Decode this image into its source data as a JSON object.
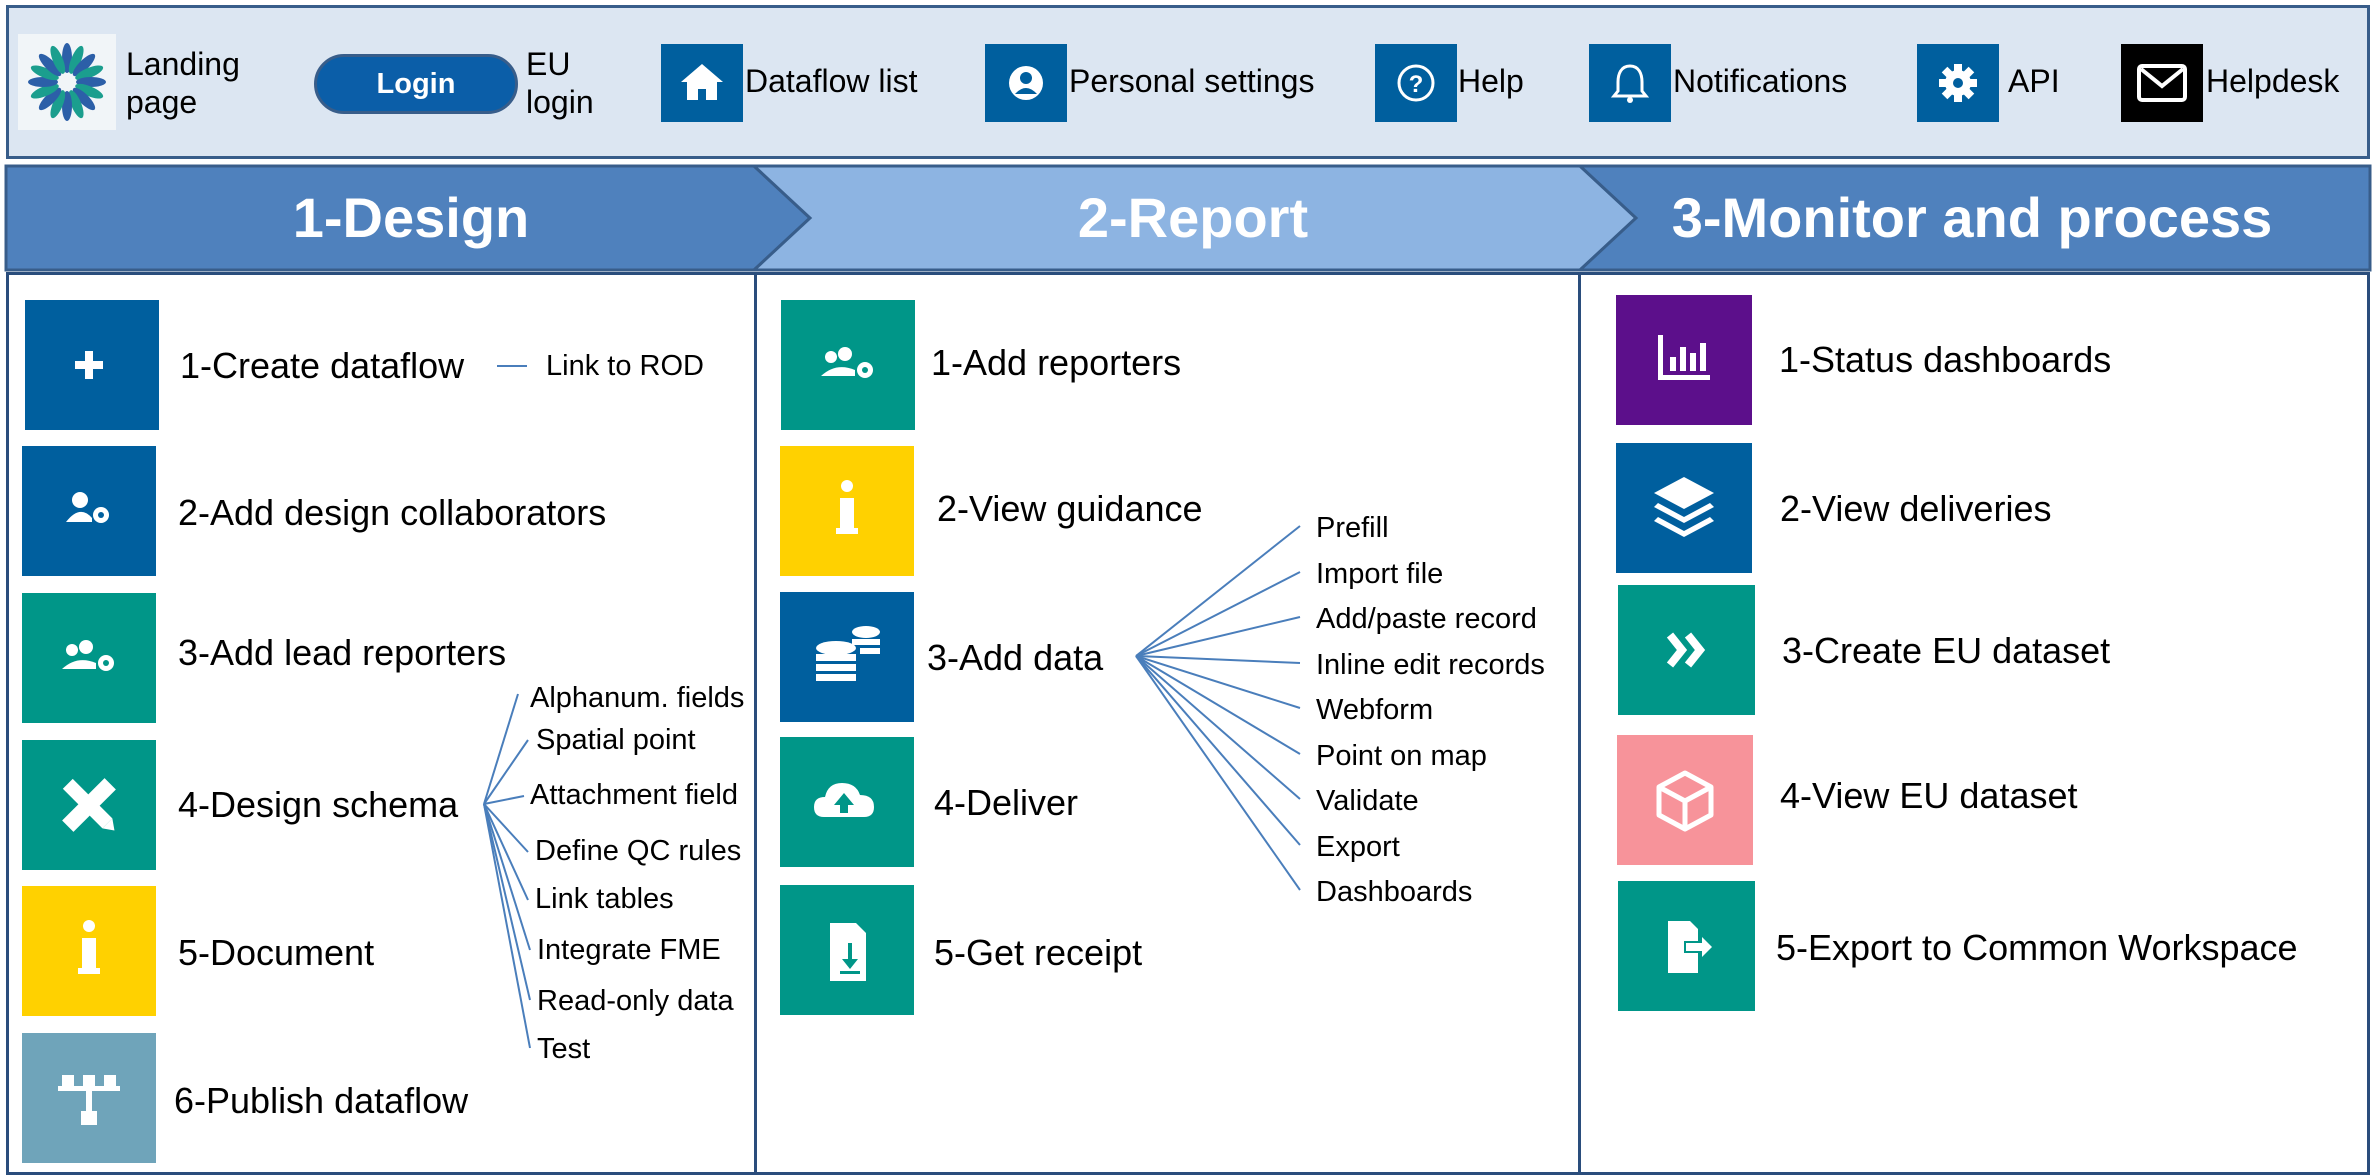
{
  "colors": {
    "blue": "#005f9e",
    "teal": "#009688",
    "yellow": "#ffd100",
    "grey_blue": "#6fa4ba",
    "purple": "#5c0f8b",
    "pink": "#f7939a",
    "header_dark": "#4f81bd",
    "header_light": "#8db4e2",
    "topbar_bg": "#dce6f2"
  },
  "topbar": {
    "landing_line1": "Landing",
    "landing_line2": "page",
    "login_button": "Login",
    "eu_line1": "EU",
    "eu_line2": "login",
    "dataflow_list": "Dataflow list",
    "personal_settings": "Personal settings",
    "help": "Help",
    "notifications": "Notifications",
    "api": "API",
    "helpdesk": "Helpdesk",
    "icons": [
      "eu-star-logo",
      "home-icon",
      "user-icon",
      "question-icon",
      "bell-icon",
      "gear-icon",
      "envelope-icon"
    ]
  },
  "headers": {
    "design": "1-Design",
    "report": "2-Report",
    "monitor": "3-Monitor and process"
  },
  "design": {
    "steps": [
      "1-Create dataflow",
      "2-Add design collaborators",
      "3-Add lead reporters",
      "4-Design schema",
      "5-Document",
      "6-Publish dataflow"
    ],
    "rod_link": "Link to ROD",
    "schema_options": [
      "Alphanum. fields",
      "Spatial point",
      "Attachment field",
      "Define QC rules",
      "Link tables",
      "Integrate FME",
      "Read-only data",
      "Test"
    ]
  },
  "report": {
    "steps": [
      "1-Add reporters",
      "2-View guidance",
      "3-Add data",
      "4-Deliver",
      "5-Get receipt"
    ],
    "data_options": [
      "Prefill",
      "Import file",
      "Add/paste record",
      "Inline edit records",
      "Webform",
      "Point on map",
      "Validate",
      "Export",
      "Dashboards"
    ]
  },
  "monitor": {
    "steps": [
      "1-Status dashboards",
      "2-View deliveries",
      "3-Create EU dataset",
      "4-View EU dataset",
      "5-Export to Common Workspace"
    ]
  }
}
